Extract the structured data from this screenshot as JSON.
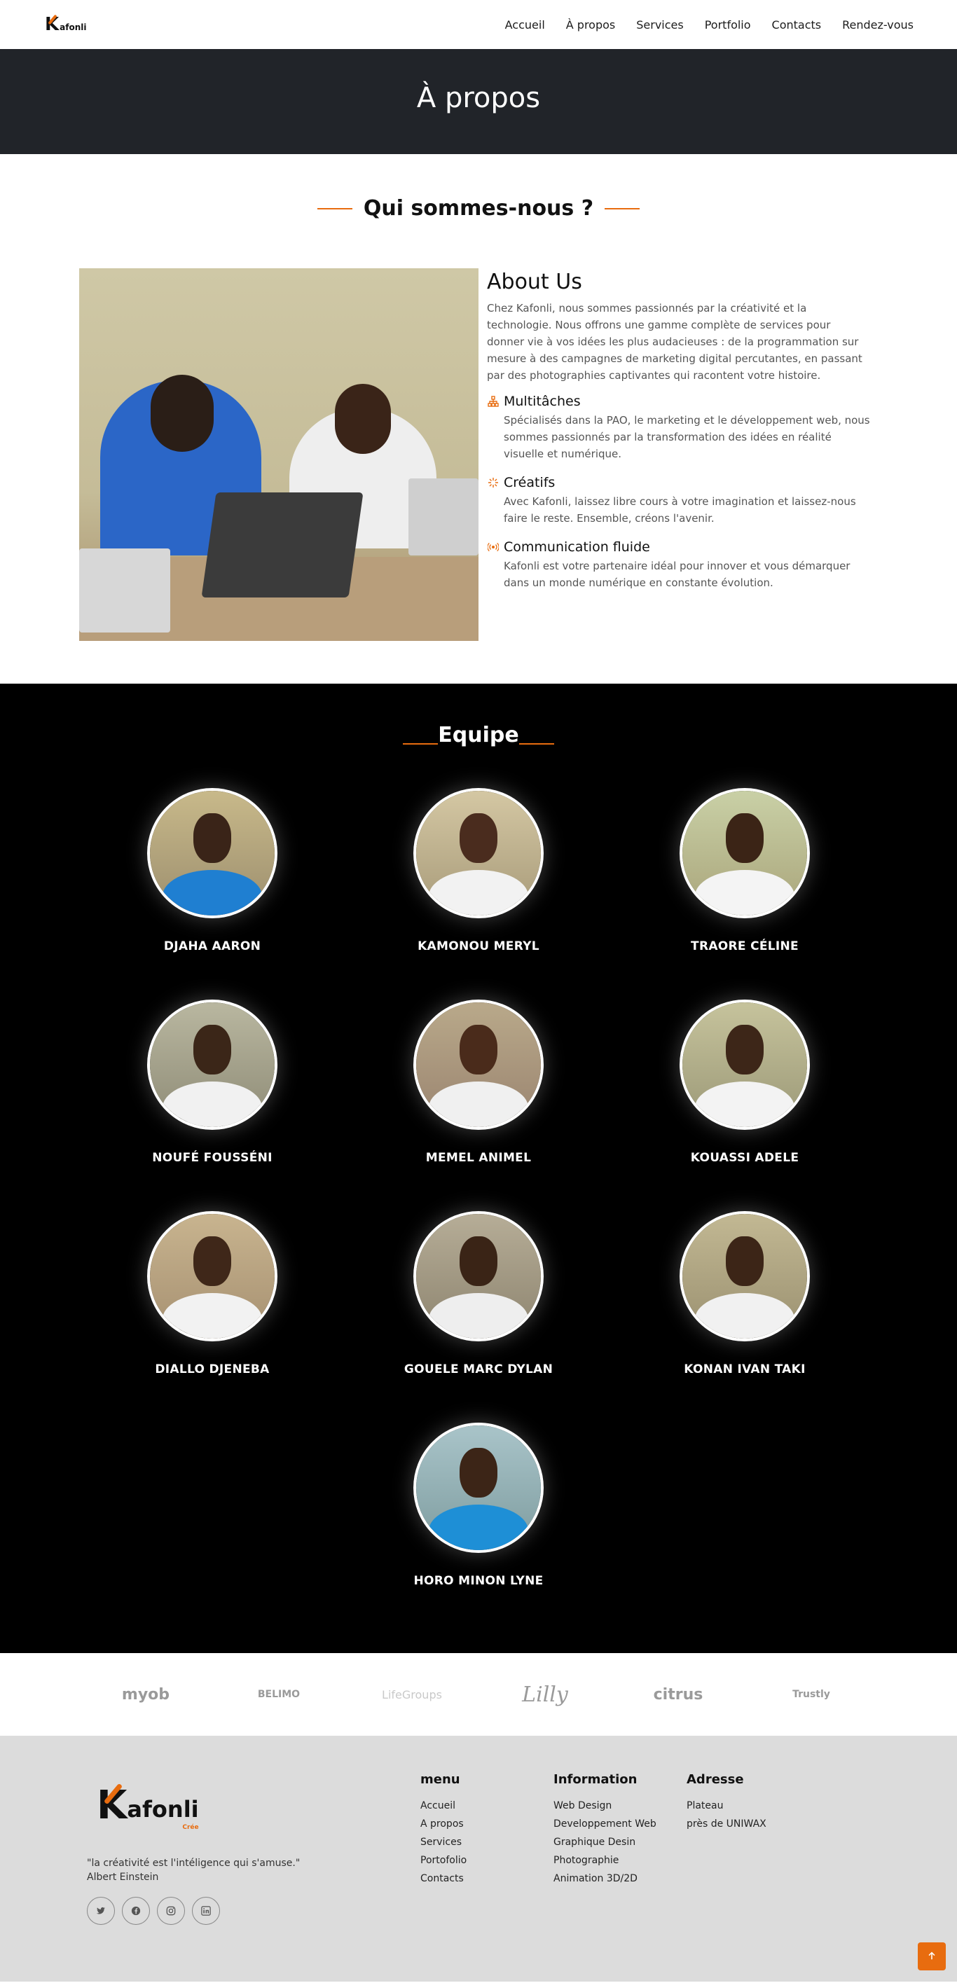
{
  "header": {
    "logo_letter": "K",
    "logo_text": "afonli",
    "nav": [
      "Accueil",
      "À propos",
      "Services",
      "Portfolio",
      "Contacts",
      "Rendez-vous"
    ]
  },
  "hero": {
    "title": "À propos"
  },
  "about": {
    "section_title": "Qui sommes-nous ?",
    "heading": "About Us",
    "lead": "Chez Kafonli, nous sommes passionnés par la créativité et la technologie. Nous offrons une gamme complète de services pour donner vie à vos idées les plus audacieuses : de la programmation sur mesure à des campagnes de marketing digital percutantes, en passant par des photographies captivantes qui racontent votre histoire.",
    "features": [
      {
        "icon": "sitemap-icon",
        "title": "Multitâches",
        "text": "Spécialisés dans la PAO, le marketing et le développement web, nous sommes passionnés par la transformation des idées en réalité visuelle et numérique."
      },
      {
        "icon": "sparkle-icon",
        "title": "Créatifs",
        "text": "Avec Kafonli, laissez libre cours à votre imagination et laissez-nous faire le reste. Ensemble, créons l'avenir."
      },
      {
        "icon": "broadcast-icon",
        "title": "Communication fluide",
        "text": "Kafonli est votre partenaire idéal pour innover et vous démarquer dans un monde numérique en constante évolution."
      }
    ]
  },
  "team": {
    "title": "Equipe",
    "members": [
      "DJAHA AARON",
      "KAMONOU MERYL",
      "TRAORE CÉLINE",
      "NOUFÉ FOUSSÉNI",
      "MEMEL ANIMEL",
      "KOUASSI ADELE",
      "DIALLO DJENEBA",
      "GOUELE MARC DYLAN",
      "KONAN IVAN TAKI",
      "HORO MINON LYNE"
    ]
  },
  "clients": [
    "myob",
    "BELIMO",
    "LifeGroups",
    "Lilly",
    "citrus",
    "Trustly"
  ],
  "footer": {
    "logo_letter": "K",
    "logo_text": "afonli",
    "logo_sub": "Crée",
    "quote": "\"la créativité est l'intéligence qui s'amuse.\"",
    "quote_author": "Albert Einstein",
    "menu": {
      "title": "menu",
      "links": [
        "Accueil",
        "A propos",
        "Services",
        "Portofolio",
        "Contacts"
      ]
    },
    "info": {
      "title": "Information",
      "links": [
        "Web Design",
        "Developpement Web",
        "Graphique Desin",
        "Photographie",
        "Animation 3D/2D"
      ]
    },
    "address": {
      "title": "Adresse",
      "lines": [
        "Plateau",
        "près de UNIWAX"
      ]
    }
  },
  "colors": {
    "accent": "#e86c0f",
    "hero_bg": "#212429",
    "team_bg": "#000000",
    "footer_bg": "#dcdcdc"
  }
}
